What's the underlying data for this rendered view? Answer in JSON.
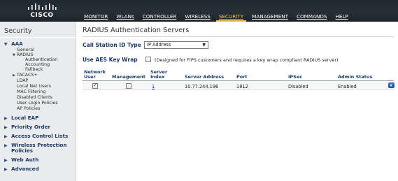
{
  "brand": {
    "logo_text": "CISCO"
  },
  "nav": [
    {
      "label": "MONITOR",
      "active": false
    },
    {
      "label": "WLANs",
      "active": false
    },
    {
      "label": "CONTROLLER",
      "active": false
    },
    {
      "label": "WIRELESS",
      "active": false
    },
    {
      "label": "SECURITY",
      "active": true
    },
    {
      "label": "MANAGEMENT",
      "active": false
    },
    {
      "label": "COMMANDS",
      "active": false
    },
    {
      "label": "HELP",
      "active": false
    }
  ],
  "sidebar": {
    "title": "Security",
    "aaa": {
      "label": "AAA",
      "items": [
        "General",
        "RADIUS",
        "Authentication",
        "Accounting",
        "Fallback",
        "TACACS+",
        "LDAP",
        "Local Net Users",
        "MAC Filtering",
        "Disabled Clients",
        "User Login Policies",
        "AP Policies"
      ]
    },
    "groups": [
      "Local EAP",
      "Priority Order",
      "Access Control Lists",
      "Wireless Protection",
      "Policies",
      "Web Auth",
      "Advanced"
    ]
  },
  "main": {
    "title": "RADIUS Authentication Servers",
    "call_station_label": "Call Station ID Type",
    "call_station_value": "IP Address",
    "aes_label": "Use AES Key Wrap",
    "aes_checked": false,
    "aes_note": "(Designed for FIPS customers and requires a key wrap compliant RADIUS server)"
  },
  "table": {
    "headers": {
      "network_user": [
        "Network",
        "User"
      ],
      "management": "Management",
      "server_index": [
        "Server",
        "Index"
      ],
      "server_address": "Server Address",
      "port": "Port",
      "ipsec": "IPSec",
      "admin_status": "Admin Status"
    },
    "rows": [
      {
        "network_user": true,
        "management": false,
        "server_index": "1",
        "server_address": "10.77.244.196",
        "port": "1812",
        "ipsec": "Disabled",
        "admin_status": "Enabled"
      }
    ]
  },
  "colors": {
    "topbar": "#232c32",
    "active_nav": "#f3c451",
    "label_blue": "#1d3a66",
    "sidebar_bg": "#e9ebec"
  },
  "icons": [
    "cisco-logo",
    "dropdown-arrow-icon",
    "triangle-expand-icon",
    "triangle-collapse-icon"
  ]
}
